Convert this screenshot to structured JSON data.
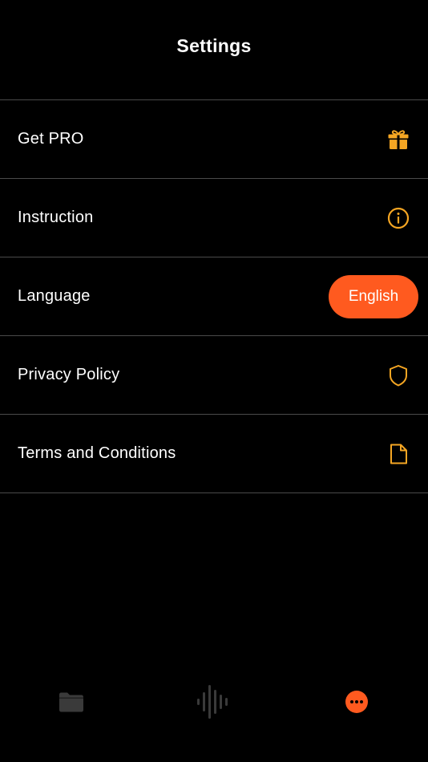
{
  "header": {
    "title": "Settings"
  },
  "settings": {
    "items": [
      {
        "label": "Get PRO",
        "icon": "gift-icon"
      },
      {
        "label": "Instruction",
        "icon": "info-icon"
      },
      {
        "label": "Language",
        "value": "English"
      },
      {
        "label": "Privacy Policy",
        "icon": "shield-icon"
      },
      {
        "label": "Terms and Conditions",
        "icon": "document-icon"
      }
    ]
  },
  "tabbar": {
    "tabs": [
      {
        "icon": "folder-icon",
        "active": false
      },
      {
        "icon": "waveform-icon",
        "active": false
      },
      {
        "icon": "more-icon",
        "active": true
      }
    ]
  },
  "colors": {
    "accent": "#ff5a1f",
    "icon_orange": "#f5a623",
    "background": "#000000",
    "divider": "#4a4a4a",
    "inactive_tab": "#3a3a3a"
  }
}
